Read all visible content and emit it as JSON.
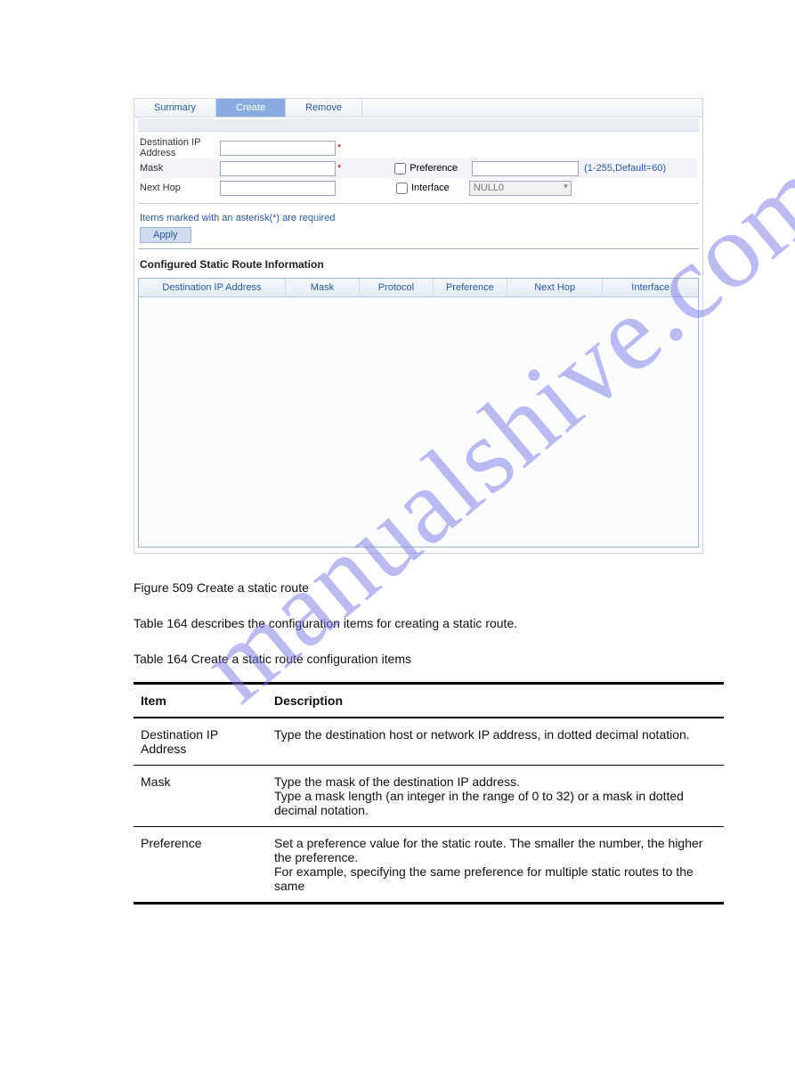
{
  "tabs": {
    "summary": "Summary",
    "create": "Create",
    "remove": "Remove"
  },
  "form": {
    "dest_label": "Destination IP Address",
    "mask_label": "Mask",
    "nexthop_label": "Next Hop",
    "pref_label": "Preference",
    "pref_hint": "(1-255,Default=60)",
    "iface_label": "Interface",
    "iface_value": "NULL0",
    "note": "Items marked with an asterisk(*) are required",
    "apply": "Apply"
  },
  "section_title": "Configured Static Route Information",
  "columns": {
    "dest": "Destination IP Address",
    "mask": "Mask",
    "proto": "Protocol",
    "pref": "Preference",
    "nexthop": "Next Hop",
    "iface": "Interface"
  },
  "figure_caption": "Figure 509 Create a static route",
  "table_caption": "Table 164 describes the configuration items for creating a static route.",
  "table_title": "Table 164 Create a static route configuration items",
  "desc_head": {
    "item": "Item",
    "desc": "Description"
  },
  "desc_rows": [
    {
      "item": "Destination IP Address",
      "desc": "Type the destination host or network IP address, in dotted decimal notation."
    },
    {
      "item": "Mask",
      "desc": "Type the mask of the destination IP address.\nType a mask length (an integer in the range of 0 to 32) or a mask in dotted decimal notation."
    },
    {
      "item": "Preference",
      "desc": "Set a preference value for the static route. The smaller the number, the higher the preference.\nFor example, specifying the same preference for multiple static routes to the same"
    }
  ],
  "watermark": "manualshive.com"
}
